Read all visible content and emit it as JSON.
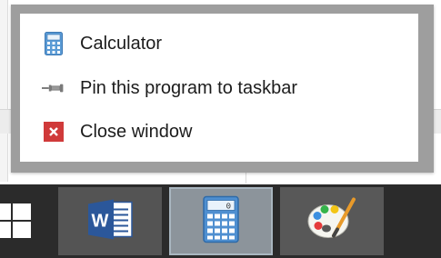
{
  "jump_list": {
    "items": [
      {
        "label": "Calculator",
        "icon": "calculator-icon"
      },
      {
        "label": "Pin this program to taskbar",
        "icon": "pin-icon"
      },
      {
        "label": "Close window",
        "icon": "close-icon",
        "icon_color": "#d03a3a"
      }
    ]
  },
  "taskbar": {
    "start_icon": "windows-logo-icon",
    "buttons": [
      {
        "app": "Word",
        "icon": "word-icon",
        "active": false
      },
      {
        "app": "Calculator",
        "icon": "calculator-icon",
        "active": true
      },
      {
        "app": "Paint",
        "icon": "paint-palette-icon",
        "active": false
      }
    ],
    "background_color": "#2b2b2b",
    "active_button_color": "#8c949b"
  },
  "icons": {
    "close_glyph": "x",
    "calculator_display": "0",
    "word_letter": "W"
  }
}
